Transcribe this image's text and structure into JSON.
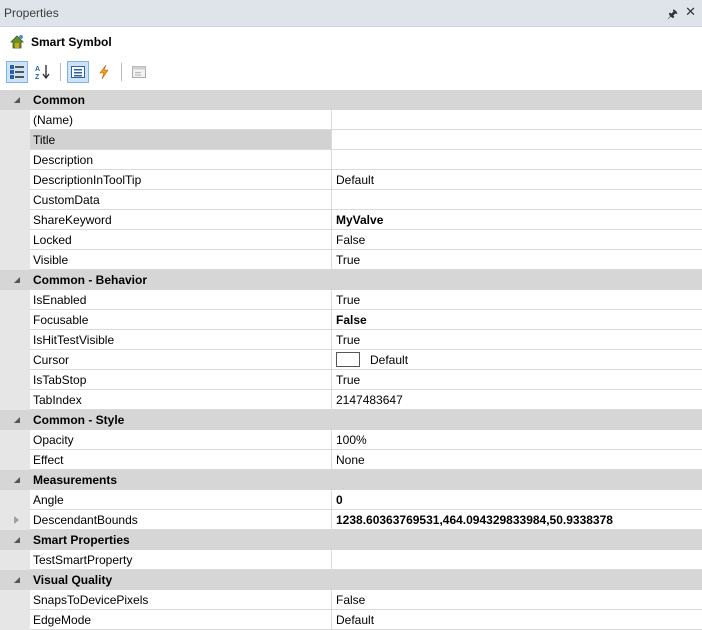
{
  "window": {
    "title": "Properties"
  },
  "object": {
    "name": "Smart Symbol"
  },
  "categories": [
    {
      "label": "Common",
      "rows": [
        {
          "name": "(Name)",
          "value": ""
        },
        {
          "name": "Title",
          "value": "",
          "selected": true
        },
        {
          "name": "Description",
          "value": ""
        },
        {
          "name": "DescriptionInToolTip",
          "value": "Default"
        },
        {
          "name": "CustomData",
          "value": ""
        },
        {
          "name": "ShareKeyword",
          "value": "MyValve",
          "bold": true
        },
        {
          "name": "Locked",
          "value": "False"
        },
        {
          "name": "Visible",
          "value": "True"
        }
      ]
    },
    {
      "label": "Common - Behavior",
      "rows": [
        {
          "name": "IsEnabled",
          "value": "True"
        },
        {
          "name": "Focusable",
          "value": "False",
          "bold": true
        },
        {
          "name": "IsHitTestVisible",
          "value": "True"
        },
        {
          "name": "Cursor",
          "value": "Default",
          "swatch": true
        },
        {
          "name": "IsTabStop",
          "value": "True"
        },
        {
          "name": "TabIndex",
          "value": "2147483647"
        }
      ]
    },
    {
      "label": "Common - Style",
      "rows": [
        {
          "name": "Opacity",
          "value": "100%"
        },
        {
          "name": "Effect",
          "value": "None"
        }
      ]
    },
    {
      "label": "Measurements",
      "rows": [
        {
          "name": "Angle",
          "value": "0",
          "bold": true
        },
        {
          "name": "DescendantBounds",
          "value": "1238.60363769531,464.094329833984,50.9338378",
          "bold": true,
          "expandable": true
        }
      ]
    },
    {
      "label": "Smart Properties",
      "rows": [
        {
          "name": "TestSmartProperty",
          "value": ""
        }
      ]
    },
    {
      "label": "Visual Quality",
      "rows": [
        {
          "name": "SnapsToDevicePixels",
          "value": "False"
        },
        {
          "name": "EdgeMode",
          "value": "Default"
        }
      ]
    }
  ],
  "icons": {
    "pin": "pin-icon",
    "close": "close-icon",
    "object": "smart-symbol-icon",
    "categorized": "categorized-icon",
    "alphabetical": "alphabetical-icon",
    "properties": "properties-icon",
    "events": "events-icon",
    "property_pages": "property-pages-icon"
  },
  "colors": {
    "category_bg": "#d6d6d6",
    "selected_bg": "#d2d2d2",
    "toolbar_active": "#cde4f7"
  }
}
